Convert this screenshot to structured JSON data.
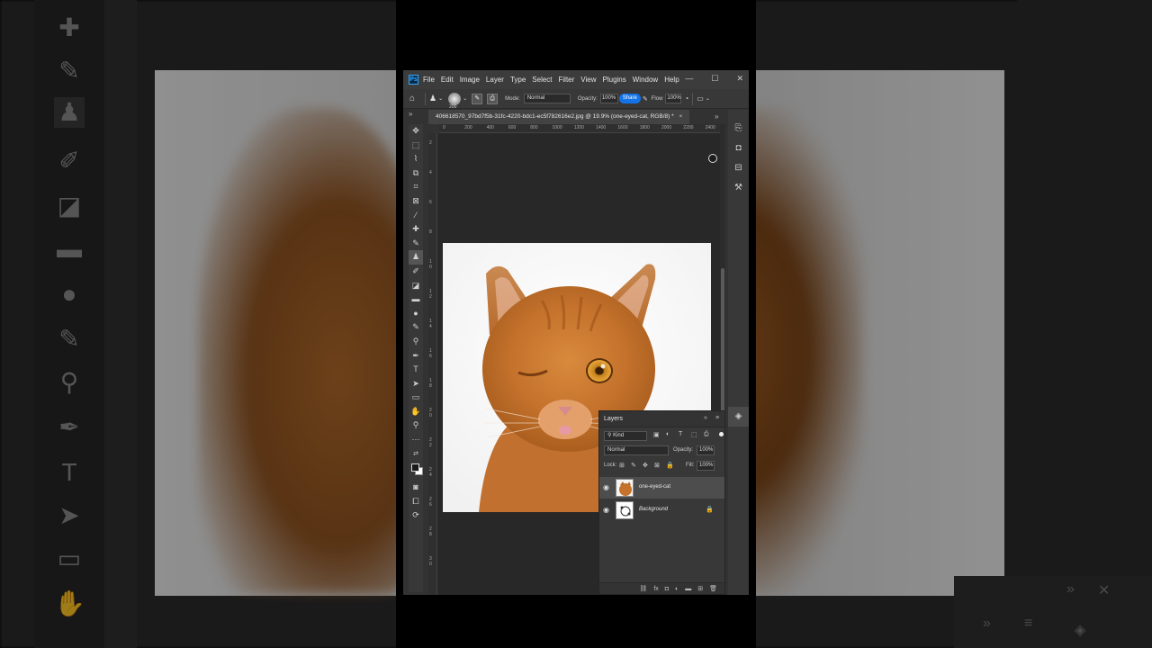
{
  "menu": {
    "logo": "Ps",
    "items": [
      "File",
      "Edit",
      "Image",
      "Layer",
      "Type",
      "Select",
      "Filter",
      "View",
      "Plugins",
      "Window",
      "Help"
    ],
    "min": "—",
    "max": "☐",
    "close": "✕"
  },
  "options": {
    "brush_size": "200",
    "mode_label": "Mode:",
    "mode_value": "Normal",
    "opacity_label": "Opacity:",
    "opacity_value": "100%",
    "share_label": "Share",
    "flow_label": "Flow",
    "flow_value": "100%"
  },
  "document": {
    "tab_title": "406618570_97bd7f5b-31fc-4220-bdc1-ec5f782616e2.jpg @ 19.9% (one-eyed-cat, RGB/8) *",
    "tab_close": "×"
  },
  "ruler": {
    "top_ticks": [
      "0",
      "200",
      "400",
      "600",
      "800",
      "1000",
      "1200",
      "1400",
      "1600",
      "1800",
      "2000",
      "2200",
      "2400"
    ],
    "left_ticks": [
      "2",
      "4",
      "6",
      "8",
      "1 0",
      "1 2",
      "1 4",
      "1 6",
      "1 8",
      "2 0",
      "2 2",
      "2 4",
      "2 6",
      "2 8",
      "3 0"
    ]
  },
  "layers_panel": {
    "title": "Layers",
    "kind_label": "Kind",
    "blend_mode": "Normal",
    "opacity_label": "Opacity:",
    "opacity_value": "100%",
    "lock_label": "Lock:",
    "fill_label": "Fill:",
    "fill_value": "100%",
    "layers": [
      {
        "name": "one-eyed-cat",
        "selected": true,
        "locked": false
      },
      {
        "name": "Background",
        "selected": false,
        "locked": true
      }
    ]
  },
  "colors": {
    "accent": "#1473e6",
    "panel": "#383838",
    "canvas_bg": "#282828",
    "cat_orange": "#c8762e"
  }
}
